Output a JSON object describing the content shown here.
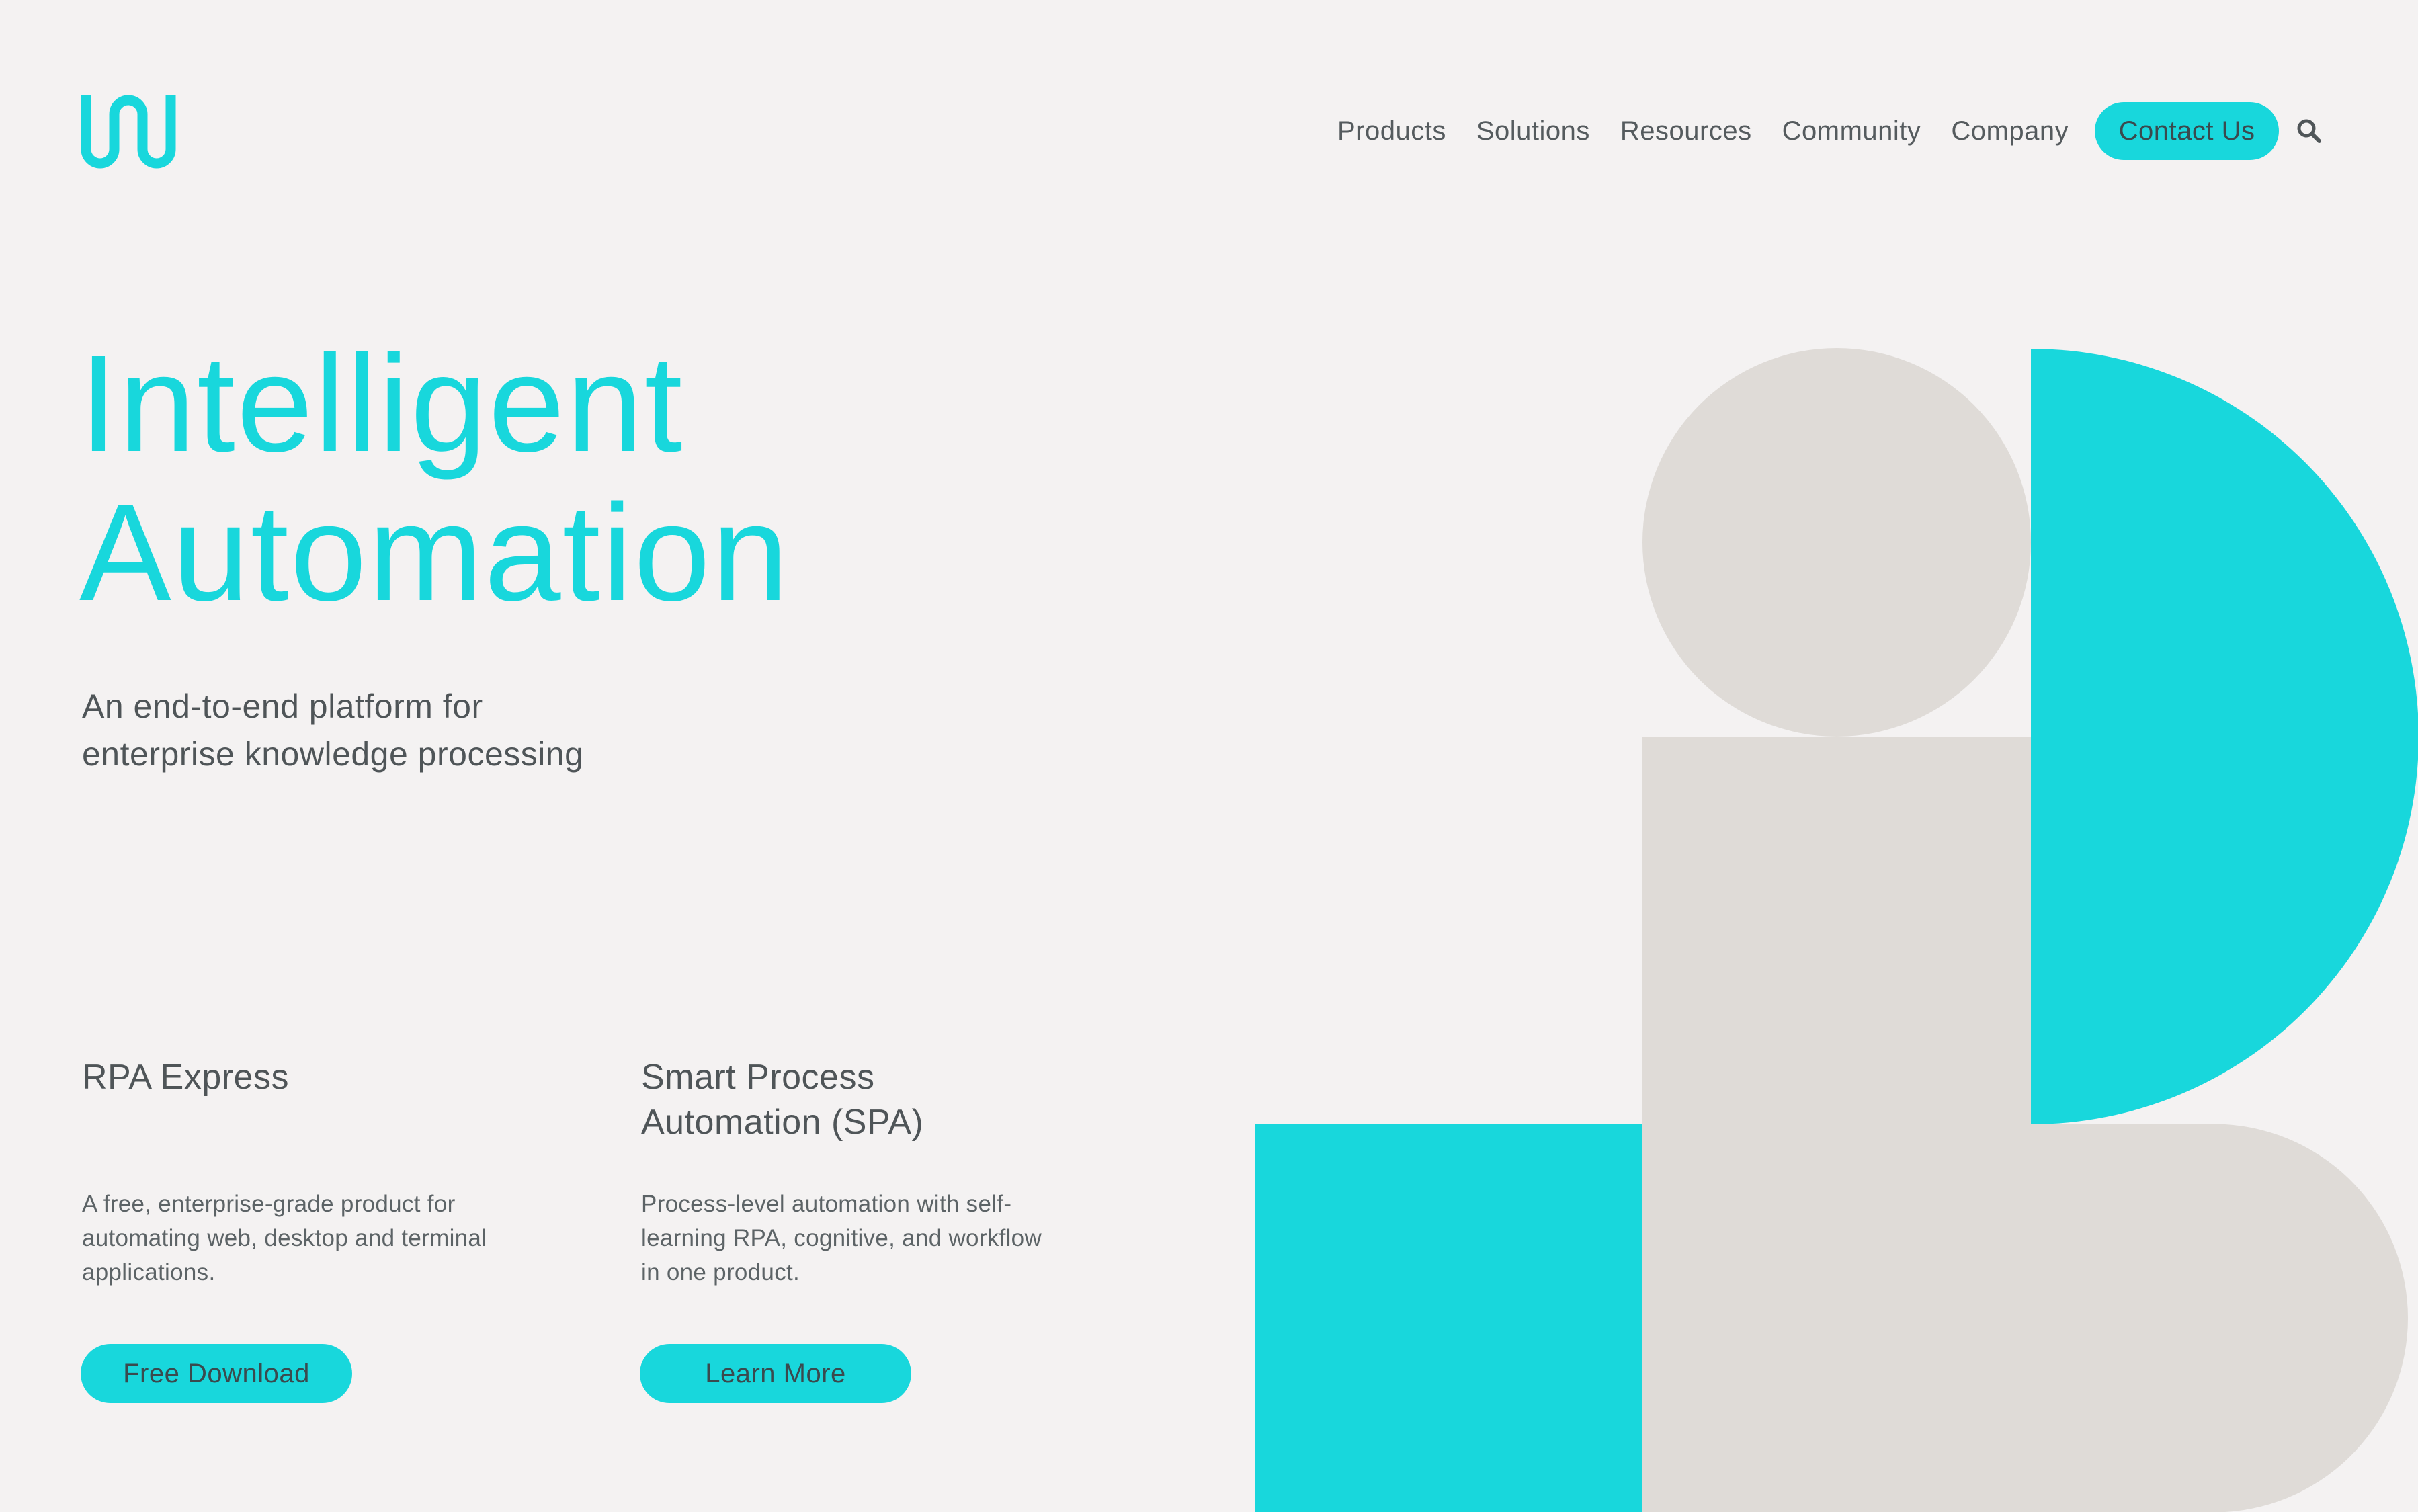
{
  "brand": {
    "logo_icon": "wave-logo-icon",
    "accent_color": "#18d7dc",
    "shape_gray": "#dfdbd7",
    "background": "#f4f2f2"
  },
  "nav": {
    "items": [
      {
        "label": "Products"
      },
      {
        "label": "Solutions"
      },
      {
        "label": "Resources"
      },
      {
        "label": "Community"
      },
      {
        "label": "Company"
      }
    ],
    "contact_label": "Contact Us",
    "search_icon": "search-icon"
  },
  "hero": {
    "title_line1": "Intelligent",
    "title_line2": "Automation",
    "subtitle_line1": "An end-to-end platform for",
    "subtitle_line2": "enterprise knowledge processing"
  },
  "products": [
    {
      "title_line1": "RPA Express",
      "title_line2": "",
      "desc_line1": "A free, enterprise-grade product for",
      "desc_line2": "automating web, desktop and terminal",
      "desc_line3": "applications.",
      "cta": "Free Download"
    },
    {
      "title_line1": "Smart Process",
      "title_line2": "Automation (SPA)",
      "desc_line1": "Process-level automation with self-",
      "desc_line2": "learning RPA, cognitive, and workflow",
      "desc_line3": "in one product.",
      "cta": "Learn More"
    }
  ]
}
